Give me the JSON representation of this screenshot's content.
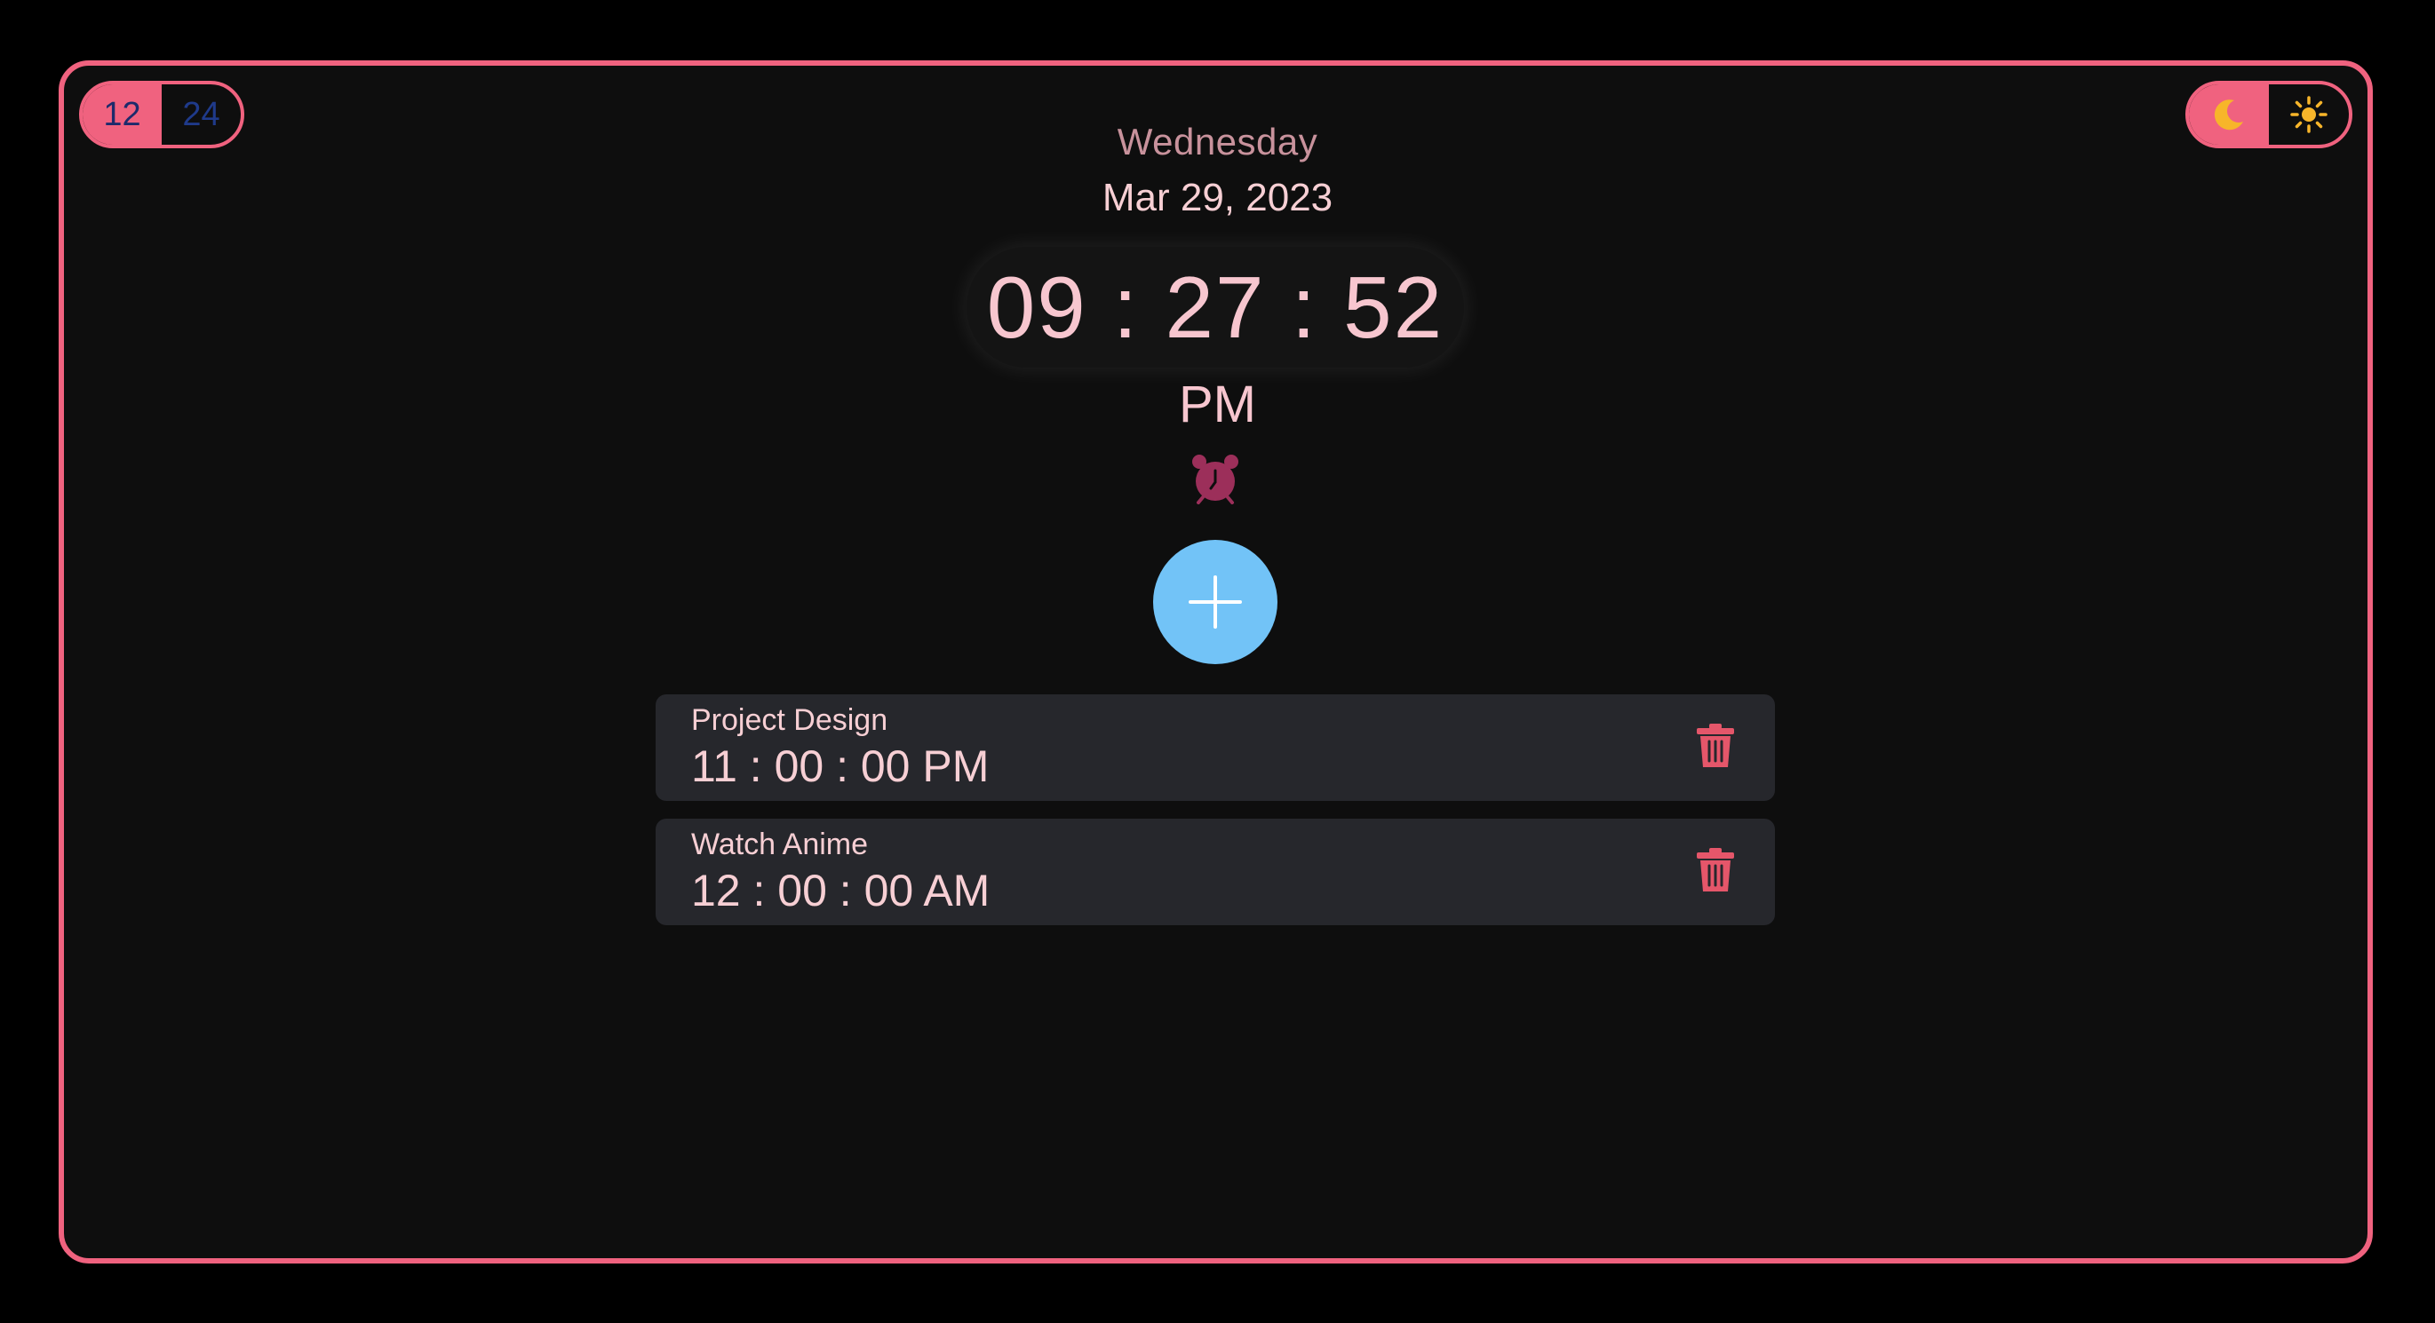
{
  "format_toggle": {
    "option_12": "12",
    "option_24": "24",
    "selected": "12"
  },
  "theme_toggle": {
    "selected": "dark",
    "dark_icon": "moon-icon",
    "light_icon": "sun-icon"
  },
  "clock": {
    "weekday": "Wednesday",
    "date": "Mar 29, 2023",
    "time": "09 : 27 : 52",
    "period": "PM"
  },
  "alarm_indicator_icon": "alarm-clock-icon",
  "add_button_icon": "plus-icon",
  "alarms": [
    {
      "title": "Project Design",
      "time": "11 : 00 : 00 PM",
      "delete_icon": "trash-icon"
    },
    {
      "title": "Watch Anime",
      "time": "12 : 00 : 00 AM",
      "delete_icon": "trash-icon"
    }
  ],
  "colors": {
    "accent": "#f0627f",
    "background": "#0e0e0e",
    "add_button": "#72c3f7",
    "card": "#26272c",
    "text": "#f7cfd4",
    "delete": "#e5566a",
    "alarm_icon": "#9c2f5a",
    "moon": "#f7b52a",
    "sun": "#f7b52a"
  }
}
